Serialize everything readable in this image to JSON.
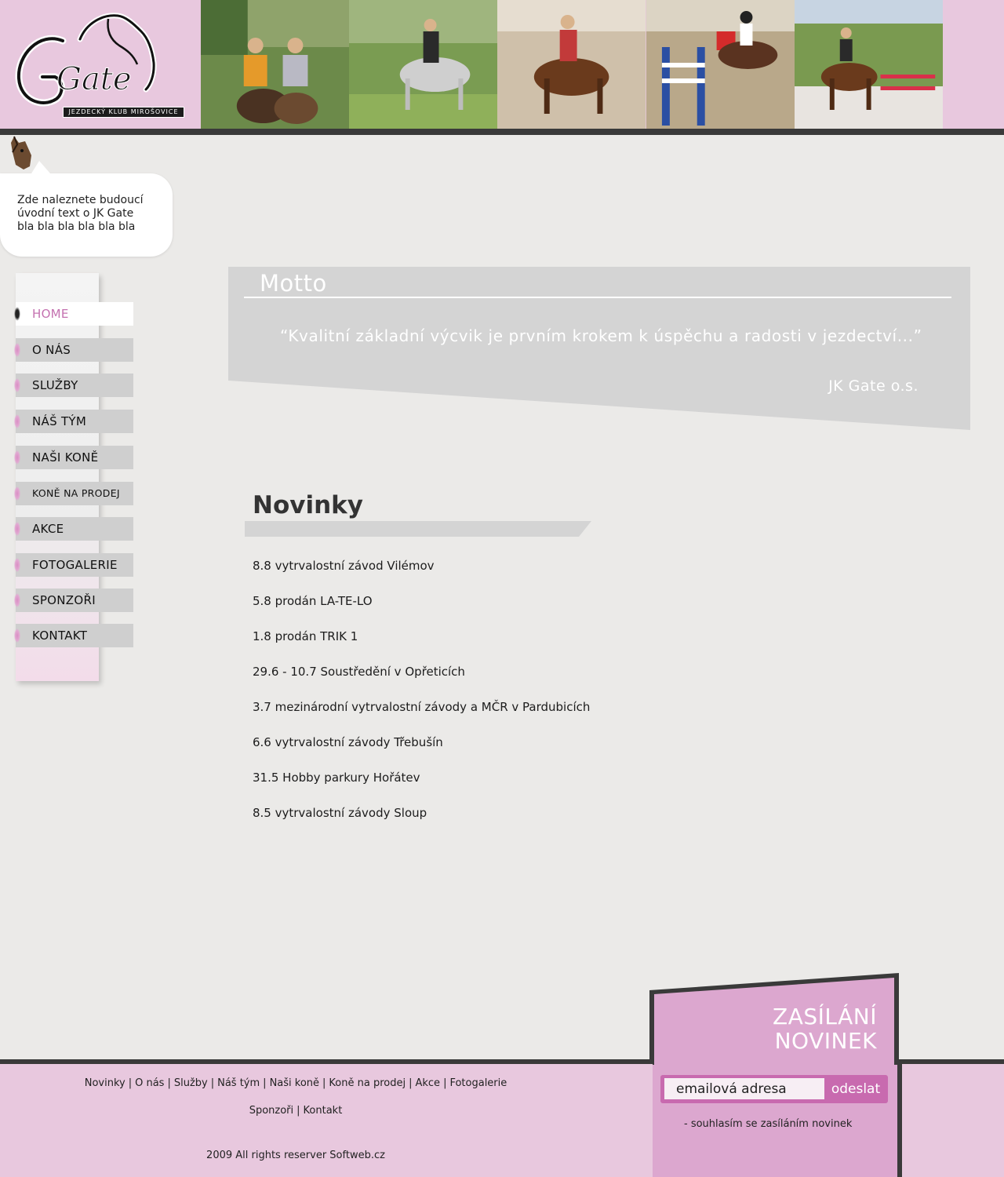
{
  "brand": {
    "logo_text": "Gate",
    "subtitle": "JEZDECKÝ KLUB MIROŠOVICE"
  },
  "header": {
    "photos": [
      {
        "name": "riders-photo-1"
      },
      {
        "name": "riders-photo-2"
      },
      {
        "name": "riders-photo-3"
      },
      {
        "name": "riders-photo-4"
      },
      {
        "name": "riders-photo-5"
      }
    ]
  },
  "intro": {
    "line1": "Zde naleznete budoucí",
    "line2": "úvodní text o JK Gate",
    "line3": "bla bla bla bla bla bla"
  },
  "nav": {
    "items": [
      {
        "label": "HOME",
        "active": true
      },
      {
        "label": "O NÁS"
      },
      {
        "label": "SLUŽBY"
      },
      {
        "label": "NÁŠ TÝM"
      },
      {
        "label": "NAŠI KONĚ"
      },
      {
        "label": "KONĚ NA PRODEJ"
      },
      {
        "label": "AKCE"
      },
      {
        "label": "FOTOGALERIE"
      },
      {
        "label": "SPONZOŘI"
      },
      {
        "label": "KONTAKT"
      }
    ]
  },
  "motto": {
    "title": "Motto",
    "quote": "“Kvalitní základní výcvik je prvním krokem k úspěchu a radosti v jezdectví...”",
    "signature": "JK Gate o.s."
  },
  "news": {
    "title": "Novinky",
    "items": [
      "8.8 vytrvalostní závod Vilémov",
      "5.8 prodán LA-TE-LO",
      "1.8 prodán TRIK 1",
      "29.6 - 10.7 Soustředění v Opřeticích",
      "3.7 mezinárodní vytrvalostní závody a MČR v Pardubicích",
      "6.6 vytrvalostní závody Třebušín",
      "31.5 Hobby parkury Hořátev",
      "8.5 vytrvalostní závody Sloup"
    ]
  },
  "footer": {
    "links_row1": [
      "Novinky",
      "O nás",
      "Služby",
      "Náš tým",
      "Naši koně",
      "Koně na prodej",
      "Akce",
      "Fotogalerie"
    ],
    "links_row2": [
      "Sponzoři",
      "Kontakt"
    ],
    "copyright": "2009 All rights reserver Softweb.cz"
  },
  "newsletter": {
    "title_line1": "ZASÍLÁNÍ",
    "title_line2": "NOVINEK",
    "email_placeholder": "emailová adresa",
    "submit_label": "odeslat",
    "consent": "- souhlasím se zasíláním novinek"
  },
  "colors": {
    "pink": "#e8c8de",
    "accent": "#c86aaf",
    "dark": "#3a3a3a",
    "panel_gray": "#d4d4d4"
  }
}
